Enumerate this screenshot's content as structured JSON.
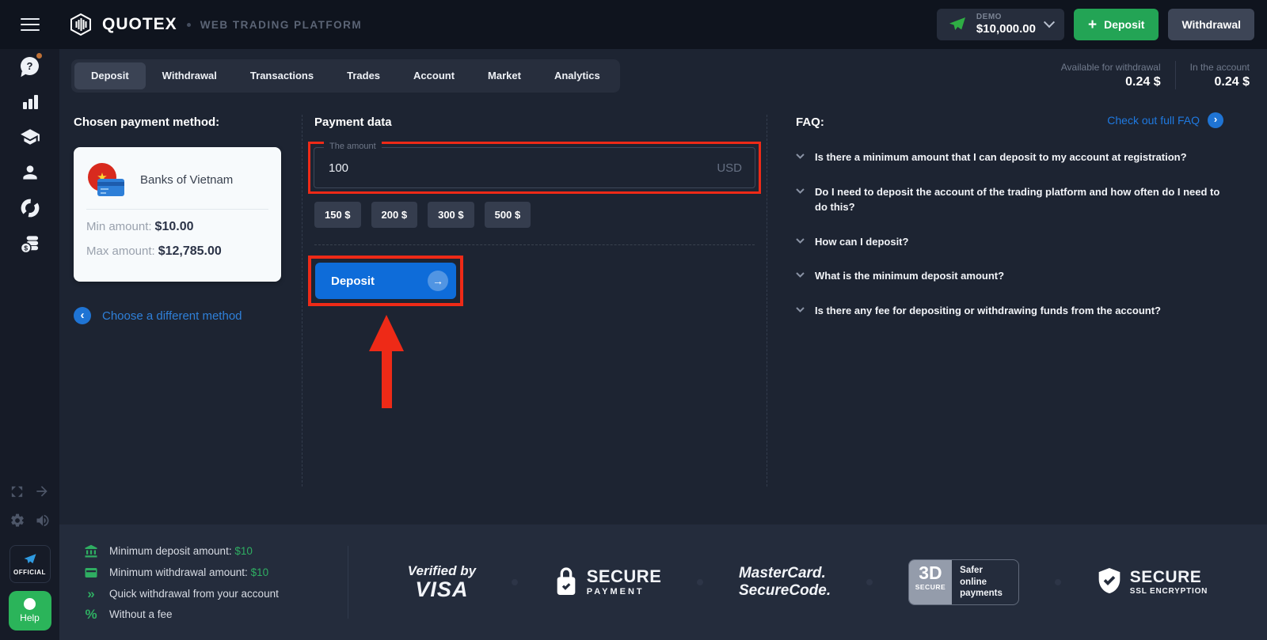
{
  "colors": {
    "accent_green": "#23a455",
    "deposit_blue": "#0e6cd9",
    "link_blue": "#2f80d9",
    "annotation_red": "#ee2a17"
  },
  "icons": {
    "plus": "+",
    "question_mark": "?",
    "star": "★",
    "chevron_left": "‹",
    "chevron_right": "›",
    "arrow_right": "→",
    "double_chevron": "»",
    "percent": "%",
    "dollar": "$"
  },
  "header": {
    "brand": "QUOTEX",
    "subtitle": "WEB TRADING PLATFORM",
    "account_type": "DEMO",
    "balance": "$10,000.00",
    "deposit_label": "Deposit",
    "withdrawal_label": "Withdrawal"
  },
  "sidebar": {
    "icons": [
      "support-chat",
      "bar-chart",
      "education",
      "profile",
      "donut-chart",
      "coins"
    ],
    "official_label": "OFFICIAL",
    "help_label": "Help"
  },
  "tabs": {
    "items": [
      "Deposit",
      "Withdrawal",
      "Transactions",
      "Trades",
      "Account",
      "Market",
      "Analytics"
    ],
    "active": "Deposit"
  },
  "balances": {
    "available_label": "Available for withdrawal",
    "available_value": "0.24 $",
    "in_account_label": "In the account",
    "in_account_value": "0.24 $"
  },
  "payment_method": {
    "heading": "Chosen payment method:",
    "name": "Banks of Vietnam",
    "min_label": "Min amount:",
    "min_value": "$10.00",
    "max_label": "Max amount:",
    "max_value": "$12,785.00",
    "change_link": "Choose a different method"
  },
  "payment_data": {
    "heading": "Payment data",
    "amount_label": "The amount",
    "amount_value": "100",
    "currency": "USD",
    "quick_amounts": [
      "150 $",
      "200 $",
      "300 $",
      "500 $"
    ],
    "deposit_label": "Deposit"
  },
  "faq": {
    "heading": "FAQ:",
    "link_label": "Check out full FAQ",
    "items": [
      "Is there a minimum amount that I can deposit to my account at registration?",
      "Do I need to deposit the account of the trading platform and how often do I need to do this?",
      "How can I deposit?",
      "What is the minimum deposit amount?",
      "Is there any fee for depositing or withdrawing funds from the account?"
    ]
  },
  "footer": {
    "info": [
      {
        "text": "Minimum deposit amount: ",
        "value": "$10"
      },
      {
        "text": "Minimum withdrawal amount: ",
        "value": "$10"
      },
      {
        "text": "Quick withdrawal from your account",
        "value": ""
      },
      {
        "text": "Without a fee",
        "value": ""
      }
    ],
    "badges": {
      "visa": {
        "line1": "Verified by",
        "line2": "VISA"
      },
      "secure_payment": {
        "line1": "SECURE",
        "line2": "PAYMENT"
      },
      "mastercard": {
        "line1": "MasterCard.",
        "line2": "SecureCode."
      },
      "threeds": {
        "big": "3D",
        "small": "SECURE",
        "side": "Safer online payments"
      },
      "ssl": {
        "line1": "SECURE",
        "line2": "SSL ENCRYPTION"
      }
    }
  }
}
